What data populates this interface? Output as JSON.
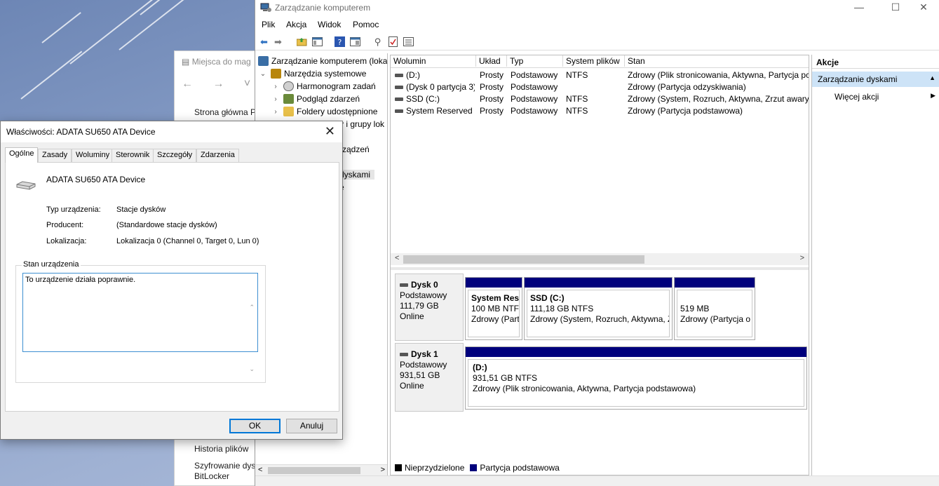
{
  "explorer": {
    "title": "Miejsca do mag",
    "nav_glyphs": "← → ˅ ↑",
    "links": [
      "Strona główna P",
      "Historia plików",
      "Szyfrowanie dys",
      "BitLocker"
    ]
  },
  "mmc": {
    "title": "Zarządzanie komputerem",
    "window_buttons": [
      "—",
      "☐",
      "✕"
    ],
    "menu": [
      "Plik",
      "Akcja",
      "Widok",
      "Pomoc"
    ],
    "toolbar_icons": [
      "back-icon",
      "forward-icon",
      "up-folder-icon",
      "show-pane-icon",
      "help-icon",
      "properties-pane-icon",
      "connect-icon",
      "check-icon",
      "list-icon"
    ],
    "tree": {
      "root": "Zarządzanie komputerem (loka",
      "system_tools": "Narzędzia systemowe",
      "items": [
        "Harmonogram zadań",
        "Podgląd zdarzeń",
        "Foldery udostępnione"
      ],
      "partial_labels": [
        "y i grupy lok",
        "rządzeń",
        "dyskami",
        "e"
      ]
    },
    "volumes": {
      "headers": [
        "Wolumin",
        "Układ",
        "Typ",
        "System plików",
        "Stan"
      ],
      "rows": [
        [
          "(D:)",
          "Prosty",
          "Podstawowy",
          "NTFS",
          "Zdrowy (Plik stronicowania, Aktywna, Partycja pc"
        ],
        [
          "(Dysk 0 partycja 3)",
          "Prosty",
          "Podstawowy",
          "",
          "Zdrowy (Partycja odzyskiwania)"
        ],
        [
          "SSD (C:)",
          "Prosty",
          "Podstawowy",
          "NTFS",
          "Zdrowy (System, Rozruch, Aktywna, Zrzut awaryj"
        ],
        [
          "System Reserved",
          "Prosty",
          "Podstawowy",
          "NTFS",
          "Zdrowy (Partycja podstawowa)"
        ]
      ]
    },
    "disks": [
      {
        "name": "Dysk 0",
        "type": "Podstawowy",
        "size": "111,79 GB",
        "status": "Online",
        "partitions": [
          {
            "name": "System Rese",
            "line2": "100 MB NTFS",
            "line3": "Zdrowy (Part"
          },
          {
            "name": "SSD  (C:)",
            "line2": "111,18 GB NTFS",
            "line3": "Zdrowy (System, Rozruch, Aktywna, Z"
          },
          {
            "name": "",
            "line2": "519 MB",
            "line3": "Zdrowy (Partycja o"
          }
        ]
      },
      {
        "name": "Dysk 1",
        "type": "Podstawowy",
        "size": "931,51 GB",
        "status": "Online",
        "partitions": [
          {
            "name": "(D:)",
            "line2": "931,51 GB NTFS",
            "line3": "Zdrowy (Plik stronicowania, Aktywna, Partycja podstawowa)"
          }
        ]
      }
    ],
    "legend": [
      {
        "label": "Nieprzydzielone",
        "color": "#000000"
      },
      {
        "label": "Partycja podstawowa",
        "color": "#00007c"
      }
    ],
    "actions": {
      "header": "Akcje",
      "selected": "Zarządzanie dyskami",
      "more": "Więcej akcji"
    }
  },
  "dialog": {
    "title": "Właściwości: ADATA SU650 ATA Device",
    "tabs": [
      "Ogólne",
      "Zasady",
      "Woluminy",
      "Sterownik",
      "Szczegóły",
      "Zdarzenia"
    ],
    "device_name": "ADATA SU650 ATA Device",
    "fields": [
      {
        "label": "Typ urządzenia:",
        "value": "Stacje dysków"
      },
      {
        "label": "Producent:",
        "value": "(Standardowe stacje dysków)"
      },
      {
        "label": "Lokalizacja:",
        "value": "Lokalizacja 0 (Channel 0, Target 0, Lun 0)"
      }
    ],
    "status_group": "Stan urządzenia",
    "status_text": "To urządzenie działa poprawnie.",
    "ok": "OK",
    "cancel": "Anuluj"
  },
  "colors": {
    "partition_bar": "#00007c",
    "selection": "#cde3f7",
    "focus": "#0078d7"
  }
}
